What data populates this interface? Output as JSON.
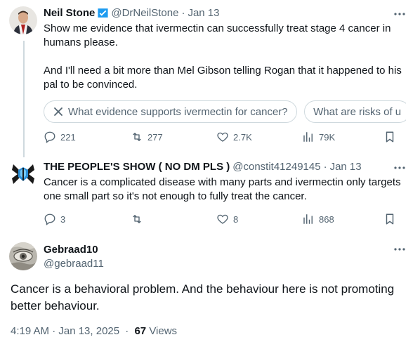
{
  "tweet1": {
    "name": "Neil Stone",
    "handle": "@DrNeilStone",
    "date": "Jan 13",
    "text_line1": "Show me evidence that ivermectin can successfully treat stage 4 cancer in humans please.",
    "text_line2": "And I'll need a bit more than Mel Gibson telling Rogan that it happened to his pal to be convinced.",
    "chips": [
      "What evidence supports ivermectin for cancer?",
      "What are risks of u"
    ],
    "replies": "221",
    "retweets": "277",
    "likes": "2.7K",
    "views": "79K"
  },
  "tweet2": {
    "name": "THE PEOPLE'S SHOW ( NO DM PLS )",
    "handle": "@constit41249145",
    "date": "Jan 13",
    "text": "Cancer is a complicated disease with many parts and ivermectin only targets one small part so it's not enough to fully treat the cancer.",
    "replies": "3",
    "likes": "8",
    "views": "868"
  },
  "tweet3": {
    "name": "Gebraad10",
    "handle": "@gebraad11",
    "text": "Cancer is a behavioral problem. And the behaviour here is not promoting better behaviour.",
    "timestamp": "4:19 AM · Jan 13, 2025",
    "views_count": "67",
    "views_label": "Views"
  },
  "separator": "·",
  "colors": {
    "text": "#0f1419",
    "secondary": "#536471",
    "verified": "#1d9bf0",
    "border": "#cfd9de"
  }
}
